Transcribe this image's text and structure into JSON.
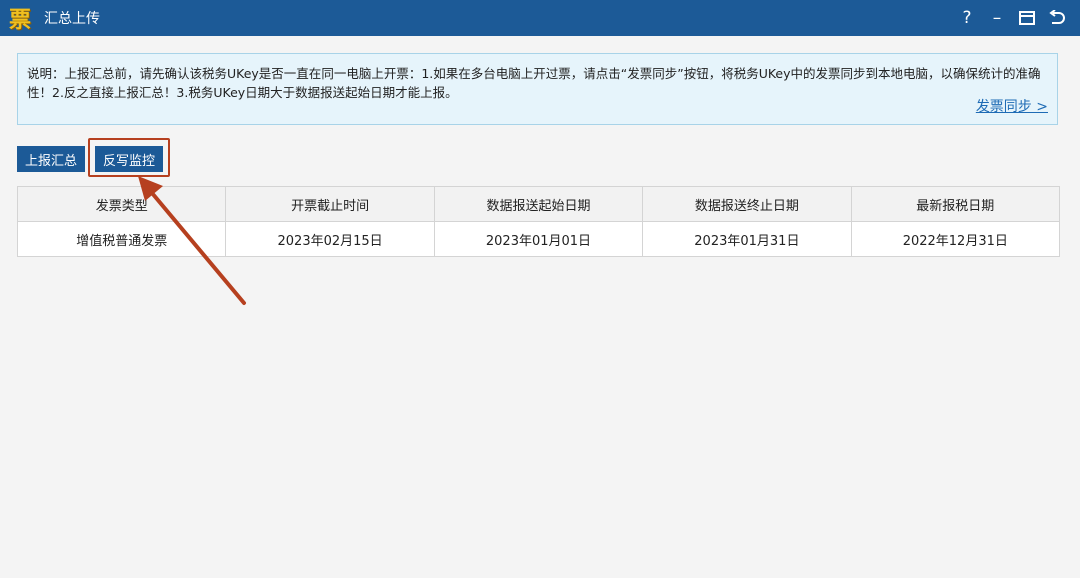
{
  "window": {
    "logo_char": "票",
    "title": "汇总上传",
    "controls": {
      "help": "?",
      "minimize": "–"
    }
  },
  "notice": {
    "text": "说明：上报汇总前，请先确认该税务UKey是否一直在同一电脑上开票：1.如果在多台电脑上开过票，请点击“发票同步”按钮，将税务UKey中的发票同步到本地电脑，以确保统计的准确性！2.反之直接上报汇总！3.税务UKey日期大于数据报送起始日期才能上报。",
    "sync_link": "发票同步 >"
  },
  "toolbar": {
    "report_label": "上报汇总",
    "rewrite_label": "反写监控"
  },
  "table": {
    "headers": [
      "发票类型",
      "开票截止时间",
      "数据报送起始日期",
      "数据报送终止日期",
      "最新报税日期"
    ],
    "rows": [
      [
        "增值税普通发票",
        "2023年02月15日",
        "2023年01月01日",
        "2023年01月31日",
        "2022年12月31日"
      ]
    ]
  },
  "colors": {
    "titlebar": "#1c5a97",
    "button": "#1c5a97",
    "annotation": "#b6401f",
    "notice_bg": "#e6f4fb",
    "link": "#1e6bb5"
  }
}
